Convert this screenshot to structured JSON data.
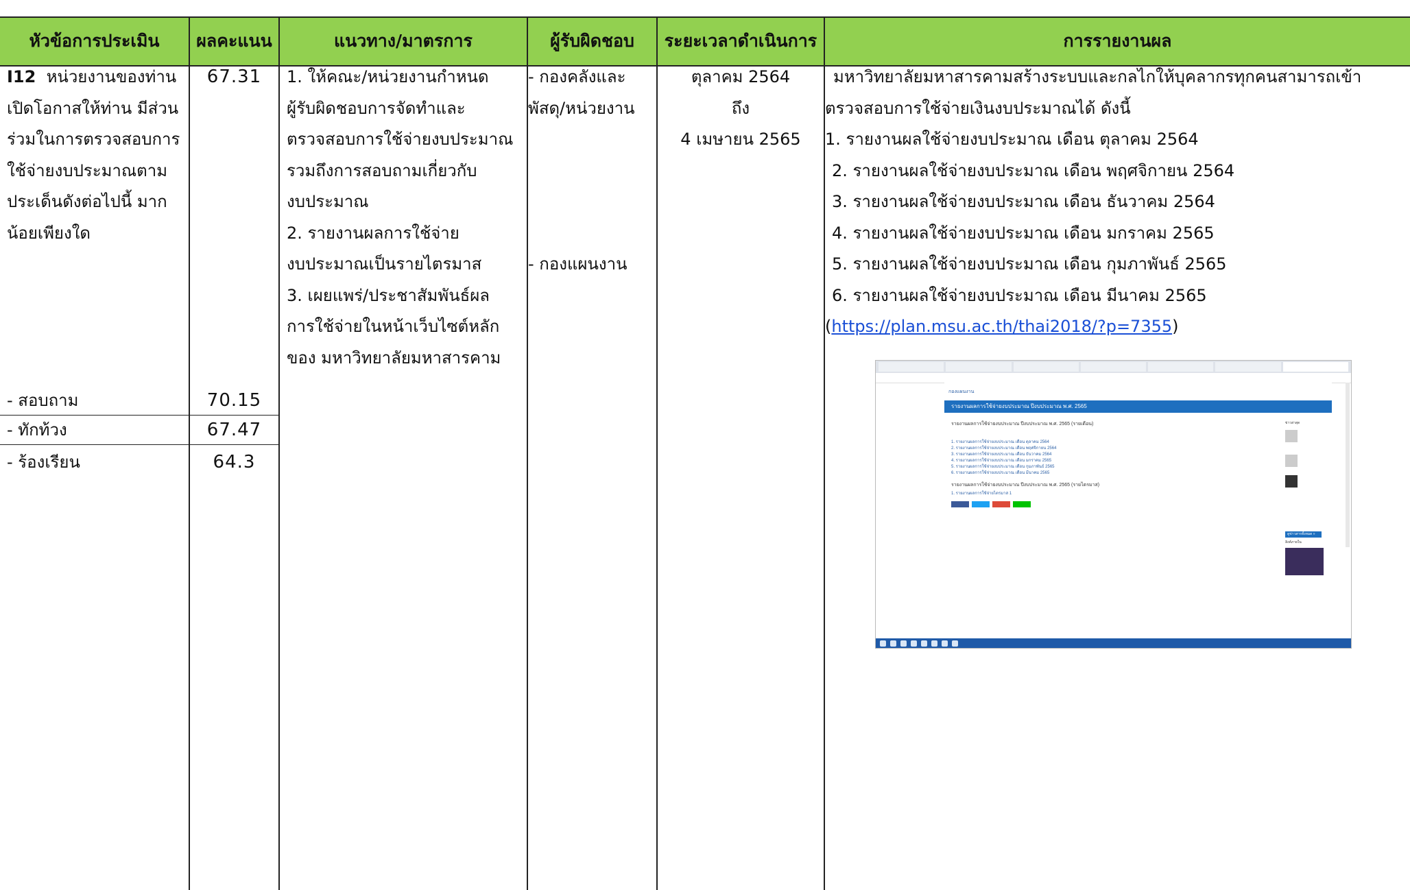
{
  "header": {
    "topic": "หัวข้อการประเมิน",
    "score": "ผลคะแนน",
    "measures": "แนวทาง/มาตรการ",
    "owner": "ผู้รับผิดชอบ",
    "period": "ระยะเวลาดำเนินการ",
    "report": "การรายงานผล"
  },
  "colors": {
    "header_bg": "#92d050",
    "link": "#1a4fd6"
  },
  "topic": {
    "code": "I12",
    "lines": [
      "หน่วยงานของท่าน",
      "เปิดโอกาสให้ท่าน มีส่วน",
      "ร่วมในการตรวจสอบการ",
      "ใช้จ่ายงบประมาณตาม",
      "ประเด็นดังต่อไปนี้ มาก",
      "น้อยเพียงใด"
    ],
    "score": "67.31",
    "sub_items": [
      {
        "label": "- สอบถาม",
        "score": "70.15"
      },
      {
        "label": "- ทักท้วง",
        "score": "67.47"
      },
      {
        "label": "- ร้องเรียน",
        "score": "64.3"
      }
    ]
  },
  "measures": {
    "lines": [
      "1. ให้คณะ/หน่วยงานกำหนด",
      "ผู้รับผิดชอบการจัดทำและ",
      "ตรวจสอบการใช้จ่ายงบประมาณ",
      "รวมถึงการสอบถามเกี่ยวกับ",
      "งบประมาณ",
      "2. รายงานผลการใช้จ่าย",
      "งบประมาณเป็นรายไตรมาส",
      "3. เผยแพร่/ประชาสัมพันธ์ผล",
      "การใช้จ่ายในหน้าเว็บไซต์หลัก",
      "ของ มหาวิทยาลัยมหาสารคาม"
    ]
  },
  "owner": {
    "first": [
      "- กองคลังและ",
      "พัสดุ/หน่วยงาน"
    ],
    "second": "- กองแผนงาน"
  },
  "period": {
    "lines": [
      "ตุลาคม 2564",
      "ถึง",
      "4 เมษายน 2565"
    ]
  },
  "report": {
    "intro": [
      "มหาวิทยาลัยมหาสารคามสร้างระบบและกลไกให้บุคลากรทุกคนสามารถเข้า",
      "ตรวจสอบการใช้จ่ายเงินงบประมาณได้  ดังนี้"
    ],
    "items": [
      "1. รายงานผลใช้จ่ายงบประมาณ เดือน ตุลาคม 2564",
      "2. รายงานผลใช้จ่ายงบประมาณ  เดือน พฤศจิกายน  2564",
      "3. รายงานผลใช้จ่ายงบประมาณ เดือน ธันวาคม 2564",
      "4. รายงานผลใช้จ่ายงบประมาณ เดือน มกราคม 2565",
      "5. รายงานผลใช้จ่ายงบประมาณ เดือน กุมภาพันธ์ 2565",
      "6. รายงานผลใช้จ่ายงบประมาณ เดือน มีนาคม 2565"
    ],
    "link_open": "(",
    "link": "https://plan.msu.ac.th/thai2018/?p=7355",
    "link_close": ")"
  },
  "screenshot": {
    "site_name": "กองแผนงาน",
    "banner": "รายงานผลการใช้จ่ายงบประมาณ ปีงบประมาณ พ.ศ. 2565",
    "post_title": "รายงานผลการใช้จ่ายงบประมาณ ปีงบประมาณ พ.ศ. 2565 (รายเดือน)",
    "post_items": [
      "1. รายงานผลการใช้จ่ายงบประมาณ เดือน ตุลาคม 2564",
      "2. รายงานผลการใช้จ่ายงบประมาณ เดือน พฤศจิกายน 2564",
      "3. รายงานผลการใช้จ่ายงบประมาณ เดือน ธันวาคม 2564",
      "4. รายงานผลการใช้จ่ายงบประมาณ เดือน มกราคม 2565",
      "5. รายงานผลการใช้จ่ายงบประมาณ เดือน กุมภาพันธ์ 2565",
      "6. รายงานผลการใช้จ่ายงบประมาณ เดือน มีนาคม 2565"
    ],
    "post_title2": "รายงานผลการใช้จ่ายงบประมาณ ปีงบประมาณ พ.ศ. 2565 (รายไตรมาส)",
    "post_item2": "1. รายงานผลการใช้จ่ายไตรมาส 1",
    "side_title": "ข่าวล่าสุด",
    "side_title2": "ลิงค์ภายใน",
    "more_button": "ดูข่าวสารทั้งหมด »"
  }
}
